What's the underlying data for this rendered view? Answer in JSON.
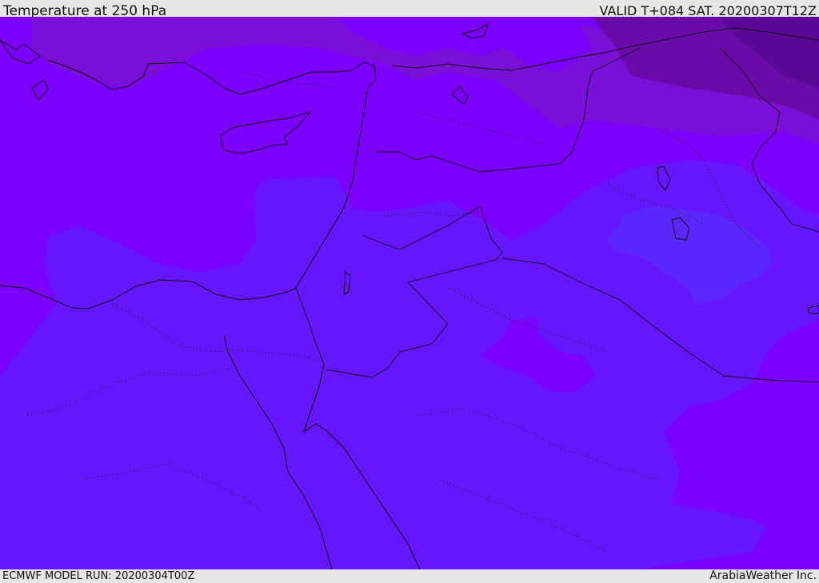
{
  "header": {
    "title": "Temperature at 250 hPa",
    "valid": "VALID T+084 SAT. 20200307T12Z"
  },
  "footer": {
    "model_run": "ECMWF MODEL RUN: 20200304T00Z",
    "credit": "ArabiaWeather Inc."
  },
  "map": {
    "variable": "temperature",
    "level": "250 hPa",
    "colors": {
      "base_violet": "#7b00ff",
      "blue_violet": "#6516ff",
      "light_blue_violet": "#5b27ff",
      "purple": "#7a10d8",
      "dark_purple": "#6a0aa8",
      "deep_purple": "#5a0896"
    }
  }
}
